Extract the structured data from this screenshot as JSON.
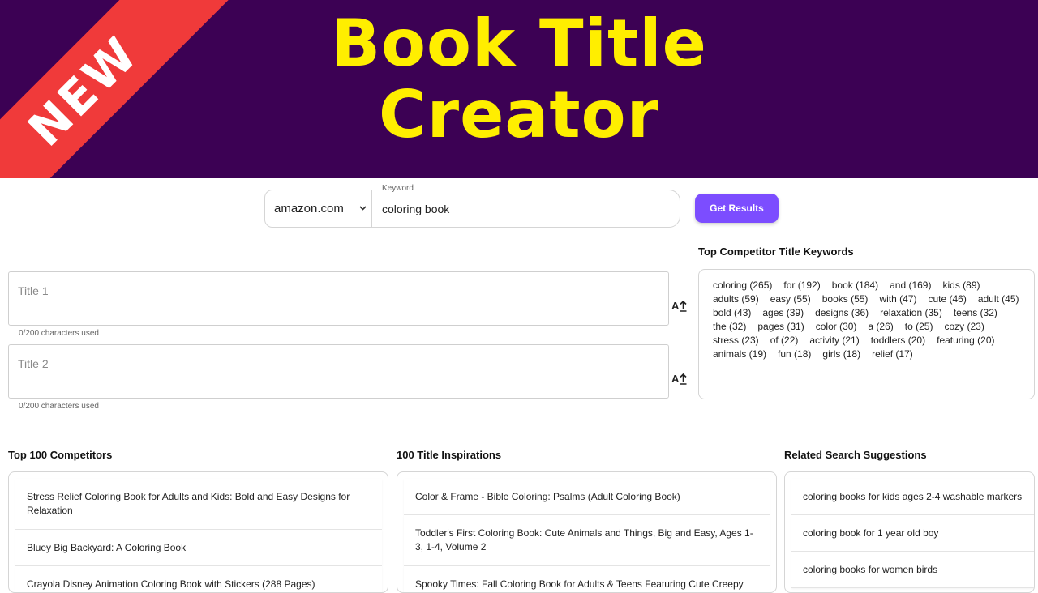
{
  "banner": {
    "ribbon": "NEW",
    "title_line1": "Book Title",
    "title_line2": "Creator",
    "colors": {
      "background": "#3c0154",
      "title": "#ffee00",
      "ribbon": "#f03a3a"
    }
  },
  "search": {
    "marketplace": "amazon.com",
    "keyword_label": "Keyword",
    "keyword_value": "coloring book",
    "button_label": "Get Results",
    "button_color": "#7c4dff"
  },
  "titles": [
    {
      "placeholder": "Title 1",
      "counter": "0/200 characters used"
    },
    {
      "placeholder": "Title 2",
      "counter": "0/200 characters used"
    }
  ],
  "keywords_panel": {
    "heading": "Top Competitor Title Keywords",
    "keywords": [
      "coloring (265)",
      "for (192)",
      "book (184)",
      "and (169)",
      "kids (89)",
      "adults (59)",
      "easy (55)",
      "books (55)",
      "with (47)",
      "cute (46)",
      "adult (45)",
      "bold (43)",
      "ages (39)",
      "designs (36)",
      "relaxation (35)",
      "teens (32)",
      "the (32)",
      "pages (31)",
      "color (30)",
      "a (26)",
      "to (25)",
      "cozy (23)",
      "stress (23)",
      "of (22)",
      "activity (21)",
      "toddlers (20)",
      "featuring (20)",
      "animals (19)",
      "fun (18)",
      "girls (18)",
      "relief (17)"
    ]
  },
  "competitors": {
    "heading": "Top 100 Competitors",
    "items": [
      "Stress Relief Coloring Book for Adults and Kids: Bold and Easy Designs for Relaxation",
      "Bluey Big Backyard: A Coloring Book",
      "Crayola Disney Animation Coloring Book with Stickers (288 Pages)"
    ]
  },
  "inspirations": {
    "heading": "100 Title Inspirations",
    "items": [
      "Color & Frame - Bible Coloring: Psalms (Adult Coloring Book)",
      "Toddler's First Coloring Book: Cute Animals and Things, Big and Easy, Ages 1-3, 1-4, Volume 2",
      "Spooky Times: Fall Coloring Book for Adults & Teens Featuring Cute Creepy"
    ]
  },
  "suggestions": {
    "heading": "Related Search Suggestions",
    "items": [
      "coloring books for kids ages 2-4 washable markers",
      "coloring book for 1 year old boy",
      "coloring books for women birds"
    ]
  }
}
